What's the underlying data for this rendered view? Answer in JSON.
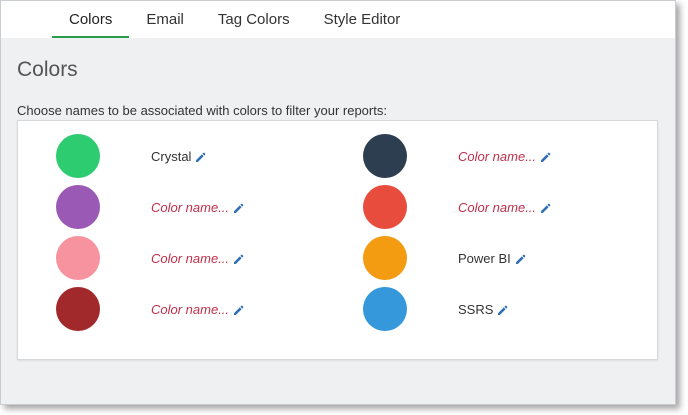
{
  "tabs": [
    {
      "label": "Colors",
      "active": true
    },
    {
      "label": "Email",
      "active": false
    },
    {
      "label": "Tag Colors",
      "active": false
    },
    {
      "label": "Style Editor",
      "active": false
    }
  ],
  "page_title": "Colors",
  "instructions": "Choose names to be associated with colors to filter your reports:",
  "icons": {
    "edit": "pencil-icon"
  },
  "colors_left": [
    {
      "color": "#2ecc71",
      "name": "Crystal",
      "placeholder": false
    },
    {
      "color": "#9b59b6",
      "name": "Color name...",
      "placeholder": true
    },
    {
      "color": "#f7939f",
      "name": "Color name...",
      "placeholder": true
    },
    {
      "color": "#a2292b",
      "name": "Color name...",
      "placeholder": true
    }
  ],
  "colors_right": [
    {
      "color": "#2c3e50",
      "name": "Color name...",
      "placeholder": true
    },
    {
      "color": "#e74c3c",
      "name": "Color name...",
      "placeholder": true
    },
    {
      "color": "#f39c12",
      "name": "Power BI",
      "placeholder": false
    },
    {
      "color": "#3498db",
      "name": "SSRS",
      "placeholder": false
    }
  ],
  "accent_color": "#2a9d4a",
  "pencil_color": "#2f6fb5"
}
